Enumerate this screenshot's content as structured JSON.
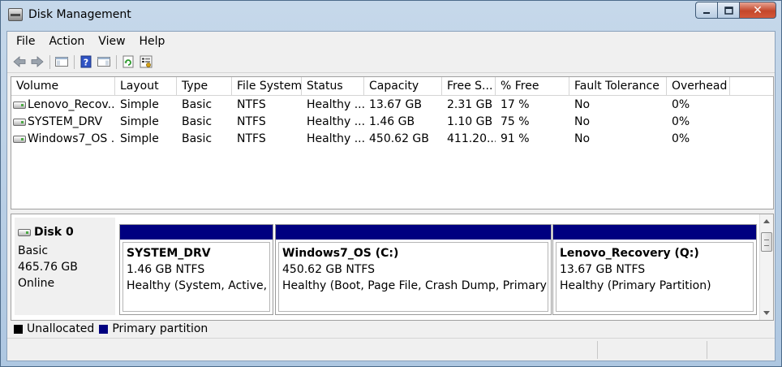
{
  "window": {
    "title": "Disk Management"
  },
  "caption": {
    "close_glyph": "✕"
  },
  "menu": [
    "File",
    "Action",
    "View",
    "Help"
  ],
  "toolbar_icons": [
    "back-arrow-icon",
    "forward-arrow-icon",
    "show-hide-console-tree-icon",
    "help-icon",
    "show-hide-action-pane-icon",
    "refresh-icon",
    "properties-icon"
  ],
  "volume_list": {
    "columns": [
      "Volume",
      "Layout",
      "Type",
      "File System",
      "Status",
      "Capacity",
      "Free S...",
      "% Free",
      "Fault Tolerance",
      "Overhead"
    ],
    "rows": [
      [
        "Lenovo_Recov...",
        "Simple",
        "Basic",
        "NTFS",
        "Healthy ...",
        "13.67 GB",
        "2.31 GB",
        "17 %",
        "No",
        "0%"
      ],
      [
        "SYSTEM_DRV",
        "Simple",
        "Basic",
        "NTFS",
        "Healthy ...",
        "1.46 GB",
        "1.10 GB",
        "75 %",
        "No",
        "0%"
      ],
      [
        "Windows7_OS ...",
        "Simple",
        "Basic",
        "NTFS",
        "Healthy ...",
        "450.62 GB",
        "411.20...",
        "91 %",
        "No",
        "0%"
      ]
    ]
  },
  "disk": {
    "name": "Disk 0",
    "type": "Basic",
    "size": "465.76 GB",
    "state": "Online",
    "partitions": [
      {
        "name": "SYSTEM_DRV",
        "size_fs": "1.46 GB NTFS",
        "status": "Healthy (System, Active, Pr"
      },
      {
        "name": "Windows7_OS  (C:)",
        "size_fs": "450.62 GB NTFS",
        "status": "Healthy (Boot, Page File, Crash Dump, Primary Par"
      },
      {
        "name": "Lenovo_Recovery  (Q:)",
        "size_fs": "13.67 GB NTFS",
        "status": "Healthy (Primary Partition)"
      }
    ]
  },
  "legend": [
    {
      "label": "Unallocated",
      "color": "#000000"
    },
    {
      "label": "Primary partition",
      "color": "#000080"
    }
  ],
  "colors": {
    "partition_header": "#000080",
    "unallocated": "#000000"
  }
}
